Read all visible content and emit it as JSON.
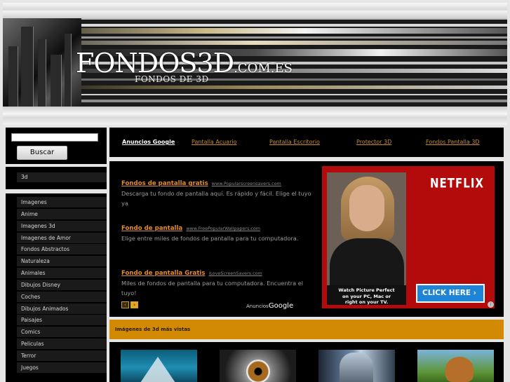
{
  "header": {
    "logo_main": "FONDOS3D",
    "logo_tld": ".COM.ES",
    "logo_sub": "FONDOS DE 3D"
  },
  "search": {
    "placeholder": "",
    "button_label": "Buscar"
  },
  "sidebar": {
    "current_category": "3d",
    "nav_items": [
      "Imagenes",
      "Anime",
      "Imagenes 3d",
      "Imagenes de Amor",
      "Fondos Abstractos",
      "Naturaleza",
      "Animales",
      "Dibujos Disney",
      "Coches",
      "Dibujos Animados",
      "Paisajes",
      "Comics",
      "Peliculas",
      "Terror",
      "Juegos"
    ]
  },
  "link_bar": {
    "title": "Anuncios Google",
    "links": [
      "Pantalla Acuario",
      "Pantalla Escritorio",
      "Protector 3D",
      "Fondos Pantalla 3D"
    ]
  },
  "ads": [
    {
      "title": "Fondos de pantalla gratis",
      "url": "www.Popularscreensavers.com",
      "description": "Descarga tu fondo de pantalla aquí. Es rápido y fácil. Elige el tuyo ya"
    },
    {
      "title": "Fondo de pantalla",
      "url": "www.FreePopularWallpapers.com",
      "description": "Elige entre miles de fondos de pantalla para tu computadora."
    },
    {
      "title": "Fondo de pantalla Gratis",
      "url": "iLoveScreenSavers.com",
      "description": "Miles de fondos de pantalla para tu computadora. Encuentra el tuyo!"
    }
  ],
  "ad_controls": {
    "prev": "‹",
    "next": "›",
    "label": "Anuncios",
    "brand": "Google"
  },
  "netflix": {
    "logo": "NETFLIX",
    "caption_line1": "Watch Picture Perfect",
    "caption_line2": "on your PC, Mac or",
    "caption_line3": "right on your TV.",
    "cta": "CLICK HERE ›",
    "info_icon": "i"
  },
  "most_viewed": {
    "title": "Imágenes de 3d más vistas"
  }
}
